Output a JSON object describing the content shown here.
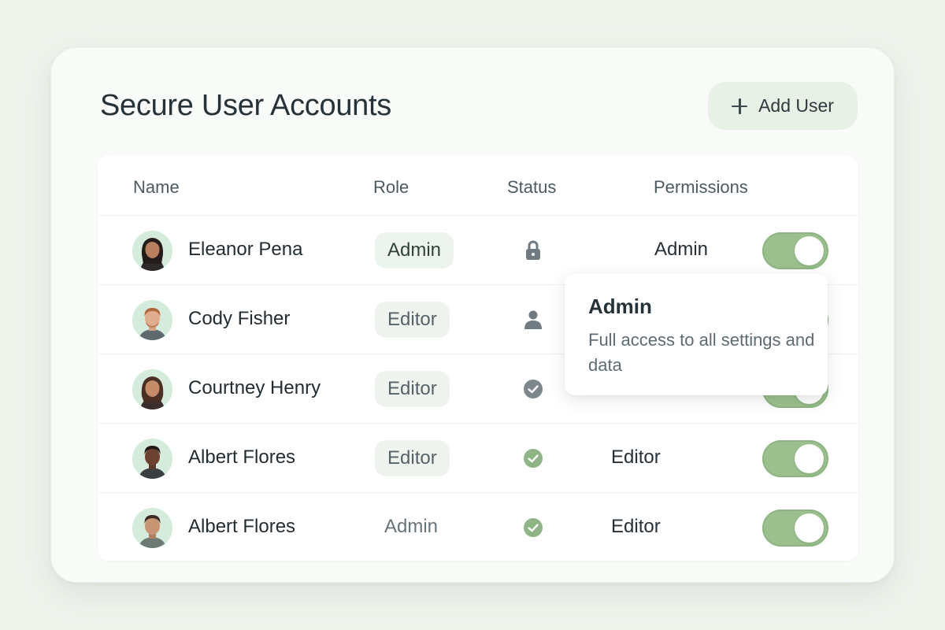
{
  "page": {
    "title": "Secure User Accounts"
  },
  "toolbar": {
    "add_user_label": "Add User",
    "add_icon": "plus-icon"
  },
  "table": {
    "columns": [
      "Name",
      "Role",
      "Status",
      "Permissions"
    ],
    "rows": [
      {
        "name": "Eleanor Pena",
        "role": "Admin",
        "status_icon": "lock-icon",
        "permission": "Admin",
        "enabled": true
      },
      {
        "name": "Cody Fisher",
        "role": "Editor",
        "status_icon": "user-icon",
        "permission": "",
        "enabled": true
      },
      {
        "name": "Courtney Henry",
        "role": "Editor",
        "status_icon": "check-circle-icon",
        "permission": "",
        "enabled": true
      },
      {
        "name": "Albert Flores",
        "role": "Editor",
        "status_icon": "check-circle-icon",
        "permission": "Editor",
        "enabled": true
      },
      {
        "name": "Albert Flores",
        "role": "Admin",
        "status_icon": "check-circle-icon",
        "permission": "Editor",
        "enabled": true
      }
    ]
  },
  "tooltip": {
    "title": "Admin",
    "body": "Full access to all settings and data"
  },
  "colors": {
    "background": "#eef3ec",
    "toggle_on": "#9bc08e",
    "status_check": "#8fb587",
    "status_neutral": "#6f7b80",
    "add_button": "#e7f1e5"
  }
}
